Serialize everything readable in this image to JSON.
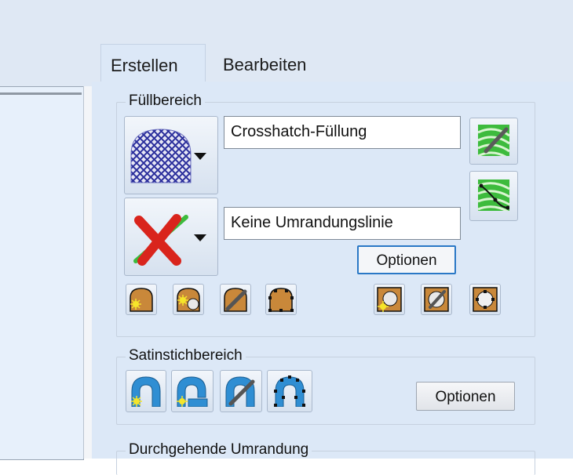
{
  "tabs": [
    {
      "label": "Erstellen",
      "active": true
    },
    {
      "label": "Bearbeiten",
      "active": false
    }
  ],
  "fill_area": {
    "group_label": "Füllbereich",
    "fill_type_value": "Crosshatch-Füllung",
    "outline_value": "Keine Umrandungslinie",
    "options_label": "Optionen",
    "fill_icon": "crosshatch-fill-icon",
    "outline_icon": "no-outline-icon"
  },
  "satin_area": {
    "group_label": "Satinstichbereich",
    "options_label": "Optionen"
  },
  "continuous_outline": {
    "group_label": "Durchgehende Umrandung"
  },
  "colors": {
    "panel_bg": "#dce8f7",
    "top_bg": "#dfe8f4",
    "focus_border": "#2a78c6",
    "shape_fill": "#c9883a",
    "satin_blue": "#2f8ed3",
    "green_icon": "#3dbb3d"
  }
}
